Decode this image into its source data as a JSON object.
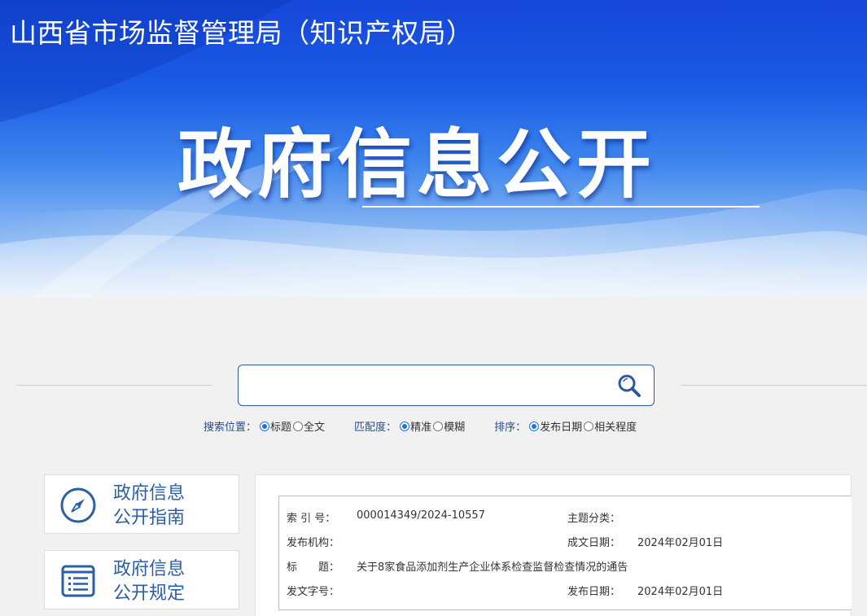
{
  "banner": {
    "org_title": "山西省市场监督管理局（知识产权局）",
    "main_title": "政府信息公开"
  },
  "search": {
    "placeholder": "",
    "value": "",
    "icon": "search-icon"
  },
  "options": {
    "position": {
      "label": "搜索位置：",
      "choices": [
        "标题",
        "全文"
      ],
      "selected": "标题"
    },
    "match": {
      "label": "匹配度：",
      "choices": [
        "精准",
        "模糊"
      ],
      "selected": "精准"
    },
    "sort": {
      "label": "排序：",
      "choices": [
        "发布日期",
        "相关程度"
      ],
      "selected": "发布日期"
    }
  },
  "sidebar": {
    "items": [
      {
        "line1": "政府信息",
        "line2": "公开指南",
        "icon": "compass-icon"
      },
      {
        "line1": "政府信息",
        "line2": "公开规定",
        "icon": "document-list-icon"
      }
    ]
  },
  "meta": {
    "index_label": "索 引 号：",
    "index_value": "000014349/2024-10557",
    "topic_label": "主题分类：",
    "topic_value": "",
    "agency_label": "发布机构：",
    "agency_value": "",
    "created_label": "成文日期：",
    "created_value": "2024年02月01日",
    "title_label": "标　　题：",
    "title_value": "关于8家食品添加剂生产企业体系检查监督检查情况的通告",
    "docno_label": "发文字号：",
    "docno_value": "",
    "published_label": "发布日期：",
    "published_value": "2024年02月01日"
  },
  "colors": {
    "brand_blue": "#1546d8",
    "accent_text": "#2b5ea7",
    "radio_checked": "#1a73e8"
  }
}
